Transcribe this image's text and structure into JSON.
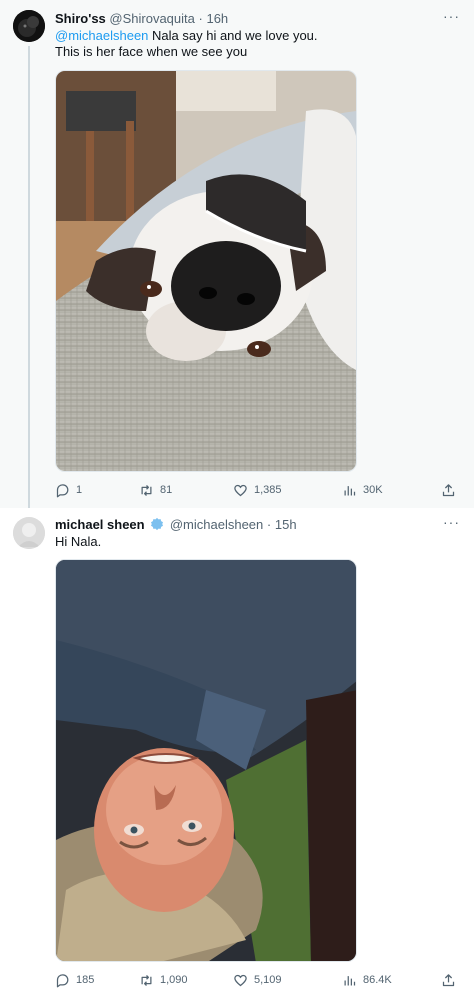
{
  "tweets": [
    {
      "author_name": "Shiro'ss",
      "handle": "@Shirovaquita",
      "separator": "·",
      "time": "16h",
      "mention": "@michaelsheen",
      "text_rest": " Nala say hi and we love you.",
      "text_line2": "This is her face when we see you",
      "stats": {
        "replies": "1",
        "retweets": "81",
        "likes": "1,385",
        "views": "30K"
      }
    },
    {
      "author_name": "michael sheen",
      "verified": true,
      "handle": "@michaelsheen",
      "separator": "·",
      "time": "15h",
      "text": "Hi Nala.",
      "stats": {
        "replies": "185",
        "retweets": "1,090",
        "likes": "5,109",
        "views": "86.4K"
      }
    }
  ],
  "more_label": "···",
  "colors": {
    "link": "#1d9bf0",
    "muted": "#536471",
    "verified": "#7cc0ef",
    "thread_line": "#cfd9de"
  },
  "icons": [
    "reply-icon",
    "retweet-icon",
    "like-icon",
    "views-icon",
    "share-icon",
    "verified-icon",
    "more-icon"
  ]
}
